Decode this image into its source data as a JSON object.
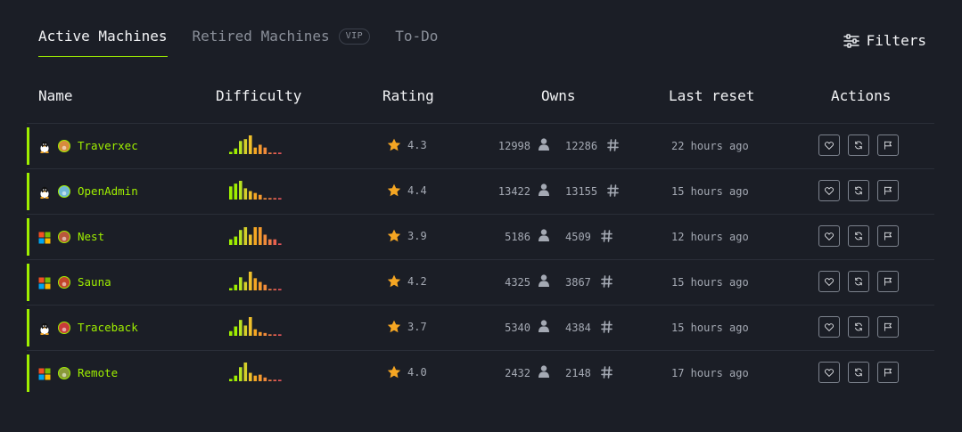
{
  "tabs": [
    {
      "label": "Active Machines",
      "active": true
    },
    {
      "label": "Retired Machines",
      "badge": "VIP",
      "active": false
    },
    {
      "label": "To-Do",
      "active": false
    }
  ],
  "filters_label": "Filters",
  "columns": {
    "name": "Name",
    "difficulty": "Difficulty",
    "rating": "Rating",
    "owns": "Owns",
    "last_reset": "Last reset",
    "actions": "Actions"
  },
  "colors": {
    "accent": "#9fef00",
    "star": "#f5a623",
    "background": "#1b1e26"
  },
  "machines": [
    {
      "os": "linux",
      "os_icon": "linux-penguin-icon",
      "name": "Traverxec",
      "difficulty_bars": [
        0.12,
        0.3,
        0.7,
        0.8,
        1.0,
        0.35,
        0.5,
        0.35,
        0.08,
        0.08,
        0.08
      ],
      "rating": "4.3",
      "user_owns": "12998",
      "root_owns": "12286",
      "last_reset": "22 hours ago"
    },
    {
      "os": "linux",
      "os_icon": "linux-penguin-icon",
      "name": "OpenAdmin",
      "difficulty_bars": [
        0.7,
        0.85,
        1.0,
        0.6,
        0.45,
        0.35,
        0.25,
        0.08,
        0.08,
        0.08,
        0.08
      ],
      "rating": "4.4",
      "user_owns": "13422",
      "root_owns": "13155",
      "last_reset": "15 hours ago"
    },
    {
      "os": "windows",
      "os_icon": "windows-logo-icon",
      "name": "Nest",
      "difficulty_bars": [
        0.3,
        0.45,
        0.8,
        0.95,
        0.55,
        0.95,
        0.95,
        0.55,
        0.3,
        0.3,
        0.08
      ],
      "rating": "3.9",
      "user_owns": "5186",
      "root_owns": "4509",
      "last_reset": "12 hours ago"
    },
    {
      "os": "windows",
      "os_icon": "windows-logo-icon",
      "name": "Sauna",
      "difficulty_bars": [
        0.12,
        0.3,
        0.7,
        0.45,
        1.0,
        0.65,
        0.45,
        0.3,
        0.08,
        0.08,
        0.08
      ],
      "rating": "4.2",
      "user_owns": "4325",
      "root_owns": "3867",
      "last_reset": "15 hours ago"
    },
    {
      "os": "linux",
      "os_icon": "linux-penguin-icon",
      "name": "Traceback",
      "difficulty_bars": [
        0.25,
        0.5,
        0.85,
        0.55,
        1.0,
        0.35,
        0.2,
        0.15,
        0.08,
        0.08,
        0.08
      ],
      "rating": "3.7",
      "user_owns": "5340",
      "root_owns": "4384",
      "last_reset": "15 hours ago"
    },
    {
      "os": "windows",
      "os_icon": "windows-logo-icon",
      "name": "Remote",
      "difficulty_bars": [
        0.12,
        0.3,
        0.75,
        1.0,
        0.45,
        0.3,
        0.35,
        0.2,
        0.08,
        0.08,
        0.08
      ],
      "rating": "4.0",
      "user_owns": "2432",
      "root_owns": "2148",
      "last_reset": "17 hours ago"
    }
  ]
}
